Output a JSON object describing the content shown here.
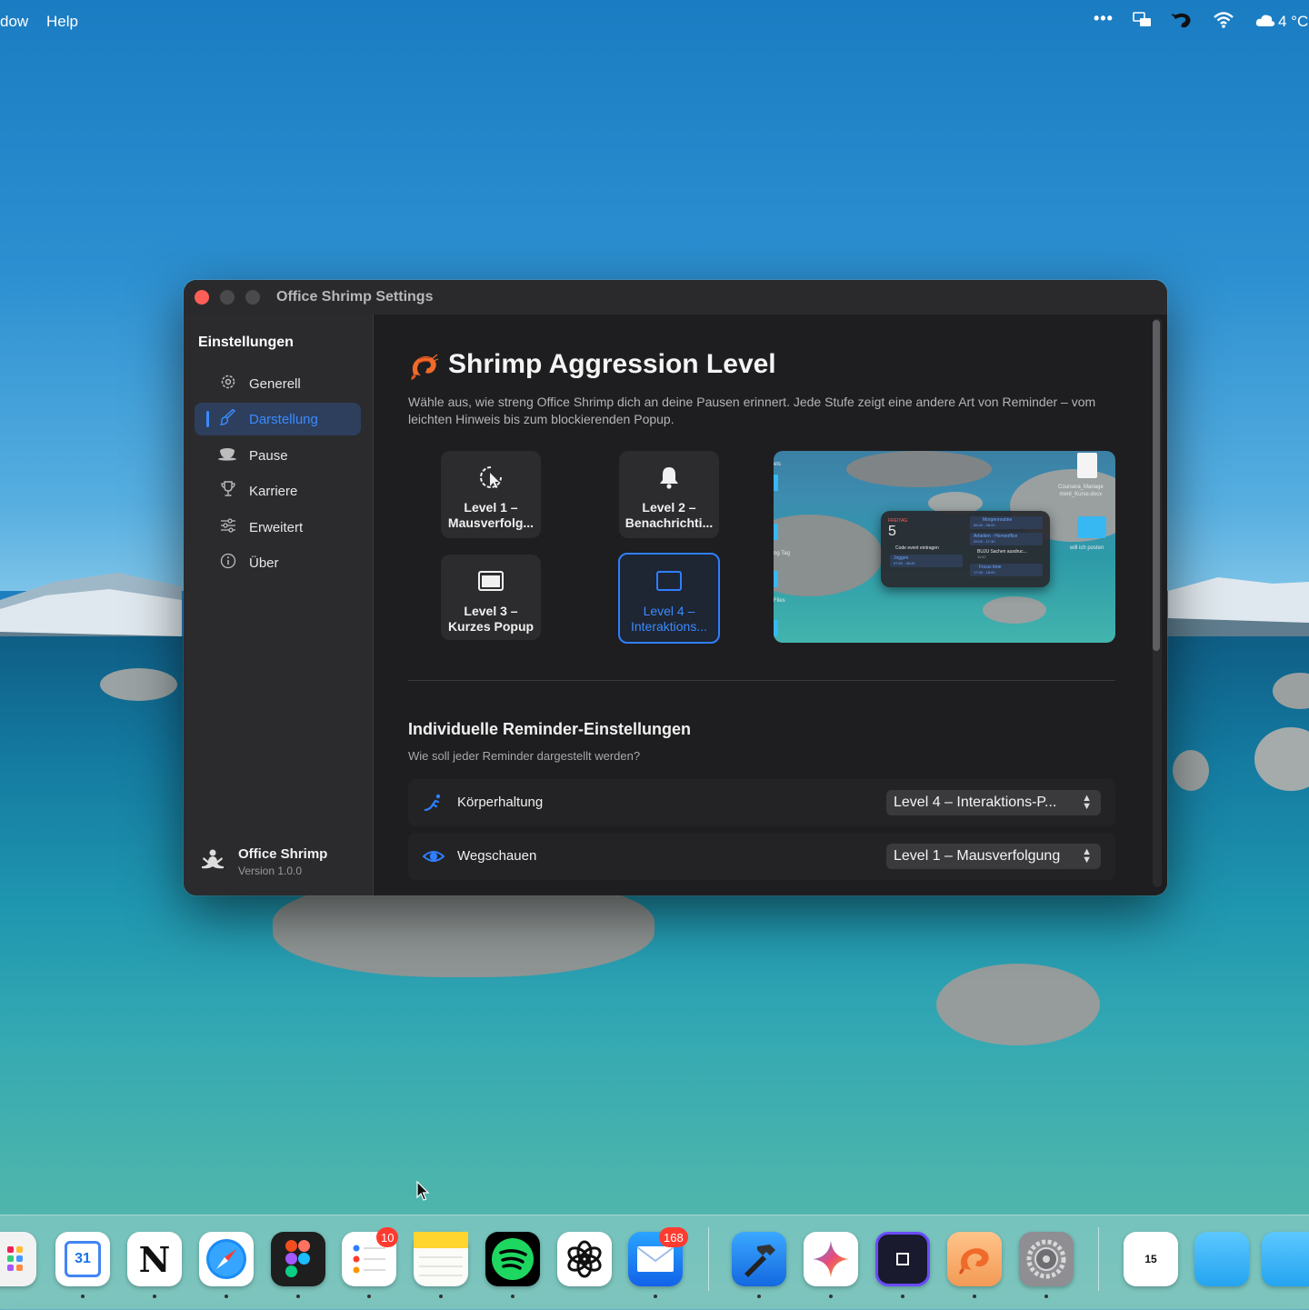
{
  "menubar": {
    "menu_window": "dow",
    "menu_help": "Help",
    "weather": "4 °C",
    "icons": [
      "more-icon",
      "display-icon",
      "shrimp-icon",
      "wifi-icon",
      "cloud-icon"
    ]
  },
  "window": {
    "title": "Office Shrimp Settings"
  },
  "sidebar": {
    "heading": "Einstellungen",
    "items": [
      {
        "label": "Generell",
        "icon": "gear-icon"
      },
      {
        "label": "Darstellung",
        "icon": "paintbrush-icon",
        "active": true
      },
      {
        "label": "Pause",
        "icon": "cup-icon"
      },
      {
        "label": "Karriere",
        "icon": "trophy-icon"
      },
      {
        "label": "Erweitert",
        "icon": "sliders-icon"
      },
      {
        "label": "Über",
        "icon": "info-icon"
      }
    ],
    "footer": {
      "app_name": "Office Shrimp",
      "version": "Version 1.0.0"
    }
  },
  "main": {
    "title": "Shrimp Aggression Level",
    "description": "Wähle aus, wie streng Office Shrimp dich an deine Pausen erinnert. Jede Stufe zeigt eine andere Art von Reminder – vom leichten Hinweis bis zum blockierenden Popup.",
    "levels": [
      {
        "label": "Level 1 –\nMausverfolg...",
        "icon": "cursor-icon"
      },
      {
        "label": "Level 2 –\nBenachrichti...",
        "icon": "bell-icon"
      },
      {
        "label": "Level 3 –\nKurzes Popup",
        "icon": "window-icon"
      },
      {
        "label": "Level 4 –\nInteraktions...",
        "icon": "square-icon",
        "selected": true
      }
    ],
    "preview": {
      "desktop_labels": [
        "Coursera_Manage\nment_Kurse.docx",
        "will ich posten",
        "ets",
        "ng Tag",
        "Files"
      ],
      "widget": {
        "day": "FREITAG",
        "date": "5",
        "events_left": [
          "Code event eintragen",
          "Joggen"
        ],
        "events_left_times": [
          "",
          "07:50 - 08:40"
        ],
        "events_right": [
          "Morgenroutine",
          "Arbeiten - Homeoffice",
          "BUJU Sachen ausdruc...",
          "Focus time"
        ],
        "events_right_times": [
          "06:40 - 08:00",
          "09:00 - 17:30",
          "11:47",
          "17:30 - 18:00"
        ]
      }
    },
    "section2": {
      "title": "Individuelle Reminder-Einstellungen",
      "subtitle": "Wie soll jeder Reminder dargestellt werden?",
      "rows": [
        {
          "label": "Körperhaltung",
          "icon": "posture-icon",
          "value": "Level 4 – Interaktions-P..."
        },
        {
          "label": "Wegschauen",
          "icon": "eye-icon",
          "value": "Level 1 – Mausverfolgung"
        }
      ]
    }
  },
  "dock": {
    "apps": [
      {
        "name": "launchpad",
        "label": ""
      },
      {
        "name": "google-calendar",
        "label": "31"
      },
      {
        "name": "notion",
        "label": "N"
      },
      {
        "name": "safari",
        "label": ""
      },
      {
        "name": "figma",
        "label": ""
      },
      {
        "name": "reminders",
        "label": "",
        "badge": "10"
      },
      {
        "name": "notes",
        "label": ""
      },
      {
        "name": "spotify",
        "label": ""
      },
      {
        "name": "chatgpt",
        "label": ""
      },
      {
        "name": "mail",
        "label": "",
        "badge": "168"
      },
      {
        "name": "xcode",
        "label": ""
      },
      {
        "name": "gemini",
        "label": ""
      },
      {
        "name": "screen-app",
        "label": ""
      },
      {
        "name": "office-shrimp",
        "label": ""
      },
      {
        "name": "system-settings",
        "label": ""
      },
      {
        "name": "calendar-widget",
        "label": "15"
      },
      {
        "name": "folder",
        "label": ""
      },
      {
        "name": "folder-2",
        "label": ""
      }
    ]
  }
}
